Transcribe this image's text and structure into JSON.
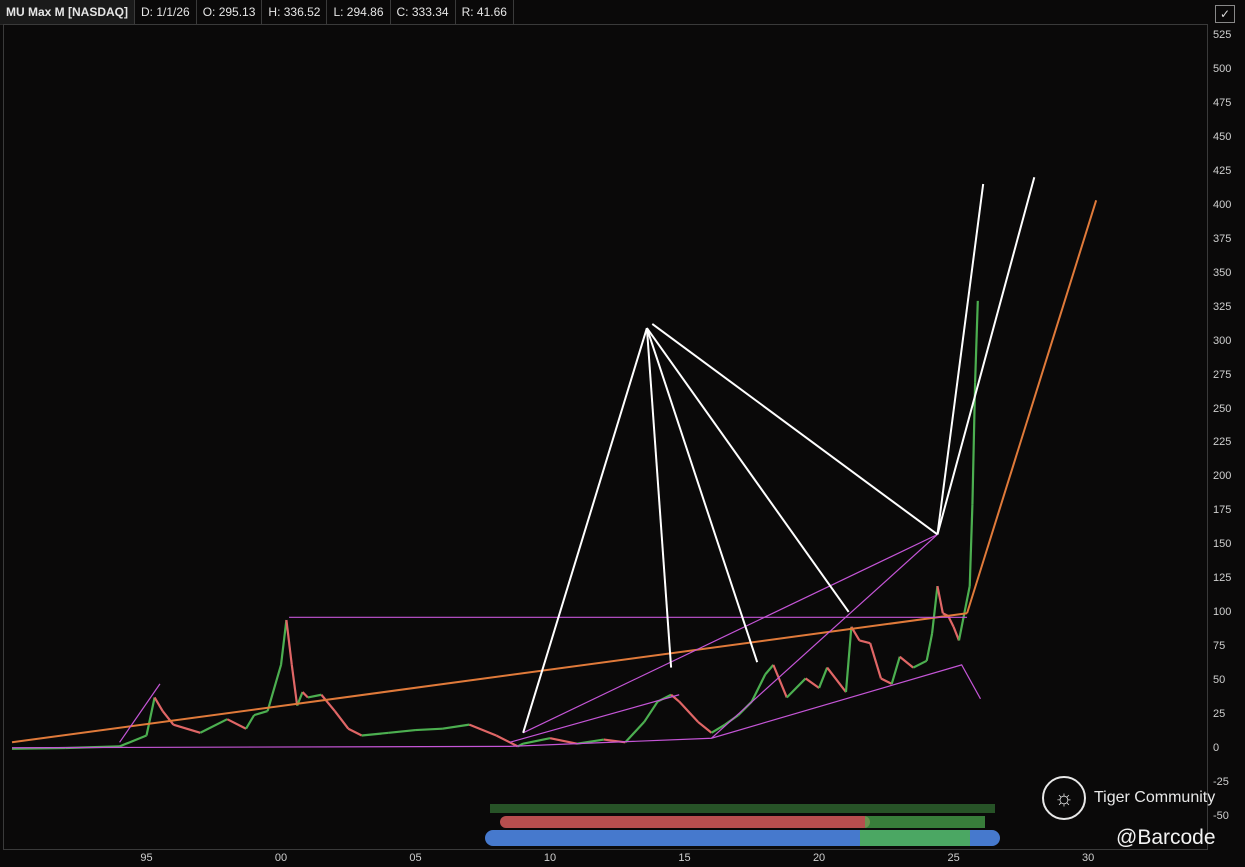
{
  "header": {
    "symbol": "MU Max M [NASDAQ]",
    "date": "D: 1/1/26",
    "open": "O: 295.13",
    "high": "H: 336.52",
    "low": "L: 294.86",
    "close": "C: 333.34",
    "range": "R: 41.66"
  },
  "corner_icon": "draw-tool-icon",
  "watermark": {
    "brand": "Tiger Community",
    "logo_icon": "tiger-community-logo-icon",
    "handle": "@Barcode"
  },
  "colors": {
    "background": "#0a0909",
    "up": "#4caf50",
    "down": "#e06666",
    "trendline_orange": "#e07a3a",
    "channel_magenta": "#c455d6",
    "fan_white": "#ffffff",
    "event_blue": "#4a7fd8"
  },
  "chart_data": {
    "type": "line",
    "series": [
      {
        "x": [
          1990.0,
          1992.0,
          1994.0,
          1995.0,
          1995.3,
          1995.6,
          1996.0,
          1997.0,
          1998.0,
          1998.7,
          1999.0,
          1999.5,
          2000.0,
          2000.2,
          2000.4,
          2000.6,
          2000.8,
          2001.0,
          2001.5,
          2002.0,
          2002.5,
          2003.0,
          2004.0,
          2005.0,
          2006.0,
          2007.0,
          2008.0,
          2008.8,
          2009.0,
          2010.0,
          2011.0,
          2012.0,
          2012.8,
          2013.5,
          2014.0,
          2014.5,
          2014.8,
          2015.5,
          2016.0,
          2016.5,
          2017.0,
          2017.5,
          2018.0,
          2018.3,
          2018.8,
          2019.5,
          2020.0,
          2020.3,
          2021.0,
          2021.2,
          2021.5,
          2021.9,
          2022.3,
          2022.7,
          2023.0,
          2023.5,
          2024.0,
          2024.2,
          2024.4,
          2024.6,
          2024.8,
          2025.0,
          2025.2,
          2025.4,
          2025.6,
          2025.7,
          2025.8,
          2025.9
        ],
        "y": [
          0.2,
          0.8,
          2,
          10,
          38,
          28,
          18,
          12,
          22,
          15,
          25,
          28,
          62,
          95,
          62,
          32,
          42,
          38,
          40,
          28,
          15,
          10,
          12,
          14,
          15,
          18,
          10,
          2,
          4,
          8,
          4,
          7,
          5,
          20,
          35,
          40,
          35,
          20,
          12,
          18,
          25,
          35,
          55,
          62,
          38,
          52,
          45,
          60,
          42,
          90,
          80,
          78,
          52,
          48,
          68,
          60,
          65,
          85,
          120,
          100,
          98,
          90,
          80,
          100,
          120,
          180,
          270,
          330
        ]
      }
    ],
    "ylim": [
      -50,
      525
    ],
    "xlim": [
      1990,
      2031
    ],
    "yticks": [
      525,
      500,
      475,
      450,
      425,
      400,
      375,
      350,
      325,
      300,
      275,
      250,
      225,
      200,
      175,
      150,
      125,
      100,
      75,
      50,
      25,
      0,
      -25,
      -50
    ],
    "xticks": [
      {
        "label": "95",
        "x": 1995
      },
      {
        "label": "00",
        "x": 2000
      },
      {
        "label": "05",
        "x": 2005
      },
      {
        "label": "10",
        "x": 2010
      },
      {
        "label": "15",
        "x": 2015
      },
      {
        "label": "20",
        "x": 2020
      },
      {
        "label": "25",
        "x": 2025
      },
      {
        "label": "30",
        "x": 2030
      }
    ],
    "trendlines": [
      {
        "color": "orange",
        "points": [
          [
            1990.0,
            5
          ],
          [
            2025.5,
            100
          ]
        ]
      },
      {
        "color": "orange",
        "points": [
          [
            2025.5,
            100
          ],
          [
            2030.3,
            404
          ]
        ]
      },
      {
        "color": "magenta",
        "points": [
          [
            1990.0,
            1
          ],
          [
            2008.5,
            2
          ],
          [
            2016.0,
            8
          ],
          [
            2025.3,
            62
          ],
          [
            2026.0,
            37
          ]
        ]
      },
      {
        "color": "magenta",
        "points": [
          [
            1994.0,
            5
          ],
          [
            1995.5,
            48
          ]
        ]
      },
      {
        "color": "magenta",
        "points": [
          [
            2000.3,
            97
          ],
          [
            2025.5,
            97
          ]
        ]
      },
      {
        "color": "magenta",
        "points": [
          [
            2008.5,
            5
          ],
          [
            2014.8,
            40
          ]
        ]
      },
      {
        "color": "magenta",
        "points": [
          [
            2016.0,
            8
          ],
          [
            2024.4,
            158
          ]
        ]
      },
      {
        "color": "magenta",
        "points": [
          [
            2009.0,
            12
          ],
          [
            2024.4,
            158
          ]
        ]
      },
      {
        "color": "white",
        "points": [
          [
            2013.6,
            310
          ],
          [
            2009.0,
            12
          ]
        ]
      },
      {
        "color": "white",
        "points": [
          [
            2013.6,
            310
          ],
          [
            2014.5,
            60
          ]
        ]
      },
      {
        "color": "white",
        "points": [
          [
            2013.6,
            310
          ],
          [
            2017.7,
            64
          ]
        ]
      },
      {
        "color": "white",
        "points": [
          [
            2013.6,
            310
          ],
          [
            2021.1,
            101
          ]
        ]
      },
      {
        "color": "white",
        "points": [
          [
            2013.8,
            313
          ],
          [
            2024.4,
            158
          ]
        ]
      },
      {
        "color": "white",
        "points": [
          [
            2024.4,
            158
          ],
          [
            2026.1,
            416
          ]
        ]
      },
      {
        "color": "white",
        "points": [
          [
            2024.4,
            158
          ],
          [
            2028.0,
            421
          ]
        ]
      }
    ]
  }
}
